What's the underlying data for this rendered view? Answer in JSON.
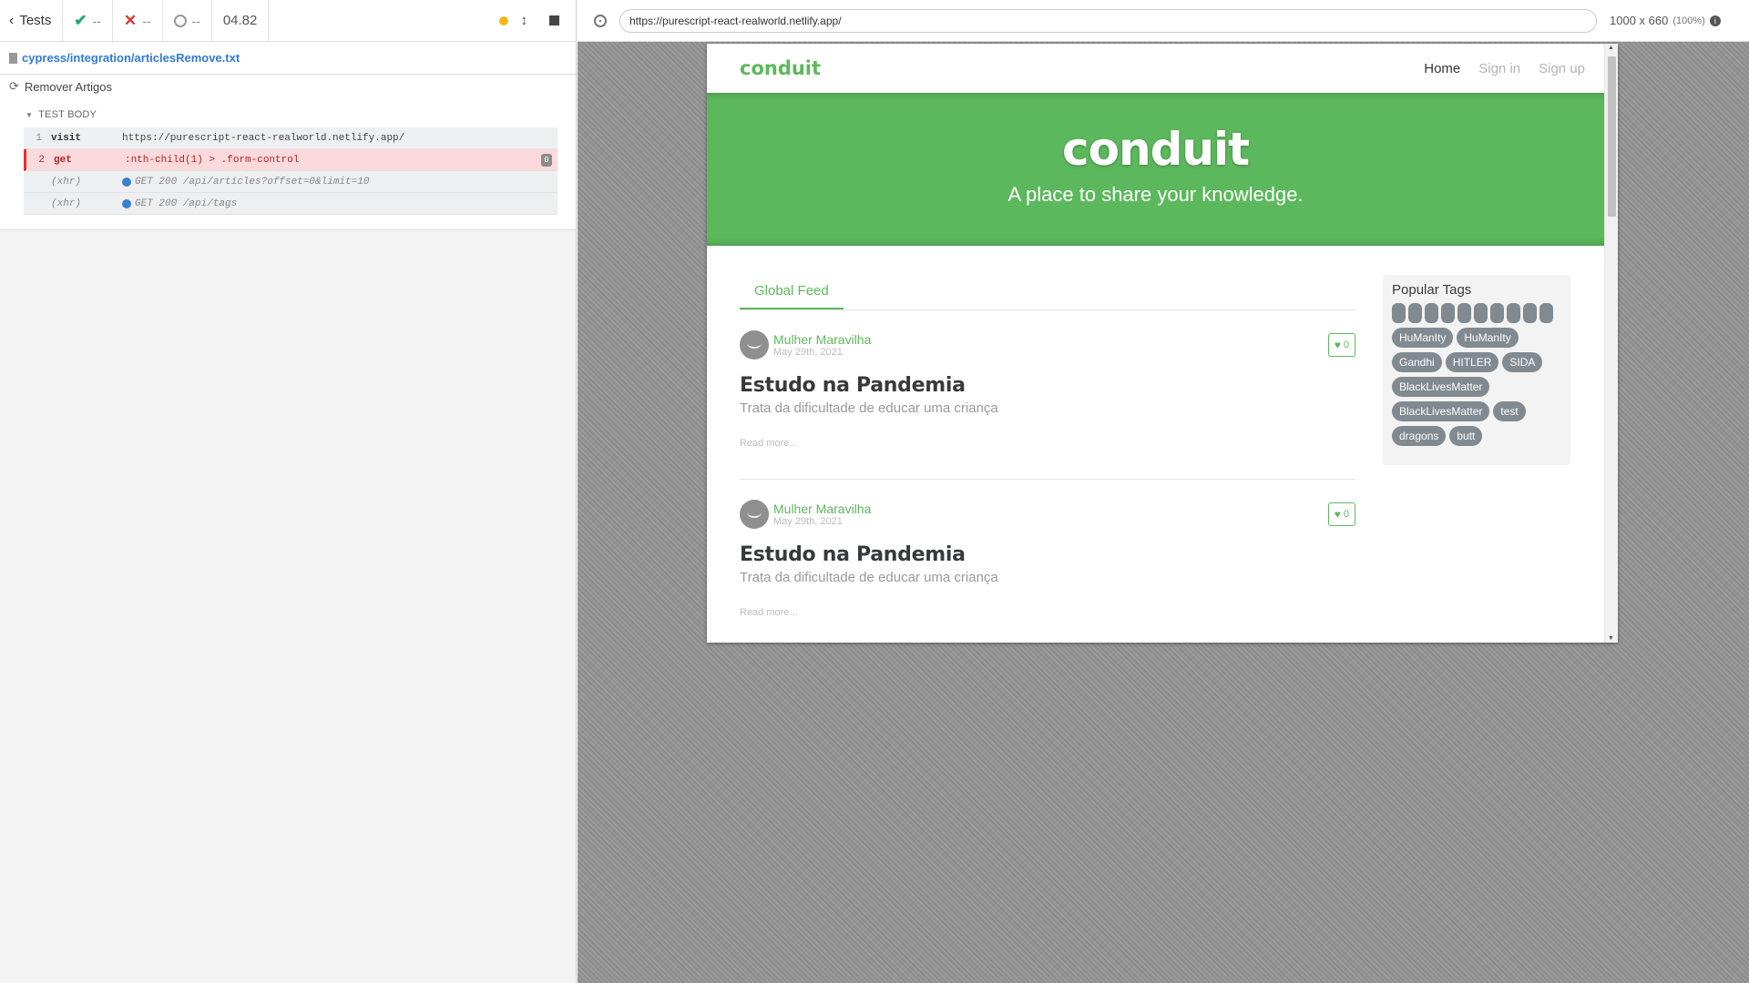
{
  "reporter": {
    "tests_label": "Tests",
    "passed": "--",
    "failed": "--",
    "pending": "--",
    "duration": "04.82",
    "spec_path": "cypress/integration/articlesRemove.txt",
    "suite_title": "Remover Artigos",
    "test_body_label": "TEST BODY",
    "commands": [
      {
        "num": "1",
        "name": "visit",
        "message": "https://purescript-react-realworld.netlify.app/"
      },
      {
        "num": "2",
        "name": "get",
        "message": ":nth-child(1) > .form-control",
        "badge": "0"
      },
      {
        "num": "",
        "name": "(xhr)",
        "message": "GET 200 /api/articles?offset=0&limit=10"
      },
      {
        "num": "",
        "name": "(xhr)",
        "message": "GET 200 /api/tags"
      }
    ]
  },
  "aut": {
    "url": "https://purescript-react-realworld.netlify.app/",
    "viewport": "1000 x 660",
    "scale": "(100%)"
  },
  "app": {
    "brand": "conduit",
    "nav": [
      "Home",
      "Sign in",
      "Sign up"
    ],
    "banner_title": "conduit",
    "banner_subtitle": "A place to share your knowledge.",
    "feed_tab": "Global Feed",
    "articles": [
      {
        "author": "Mulher Maravilha",
        "date": "May 29th, 2021",
        "likes": "0",
        "title": "Estudo na Pandemia",
        "description": "Trata da dificultade de educar uma criança",
        "read_more": "Read more..."
      },
      {
        "author": "Mulher Maravilha",
        "date": "May 29th, 2021",
        "likes": "0",
        "title": "Estudo na Pandemia",
        "description": "Trata da dificultade de educar uma criança",
        "read_more": "Read more..."
      }
    ],
    "popular_tags_title": "Popular Tags",
    "empty_tag_count": 10,
    "tags": [
      "HuManIty",
      "HuManIty",
      "Gandhi",
      "HITLER",
      "SIDA",
      "BlackLivesMatter",
      "BlackLivesMatter",
      "test",
      "dragons",
      "butt"
    ]
  },
  "colors": {
    "brand_green": "#5cb85c",
    "tag_gray": "#818a91",
    "fail_red": "#e0342f",
    "pass_green": "#1fa971",
    "link_blue": "#2f7bd6"
  }
}
